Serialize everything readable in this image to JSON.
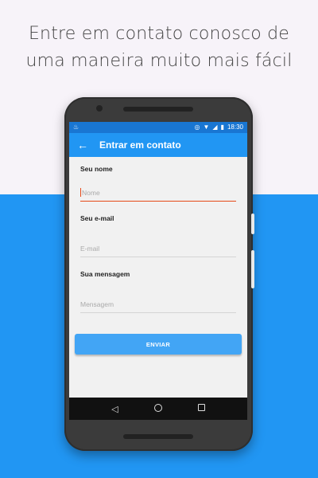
{
  "headline": {
    "line1": "Entre em contato conosco de",
    "line2": "uma maneira muito mais fácil"
  },
  "statusbar": {
    "time": "18:30",
    "icons": [
      "android-icon",
      "vibrate-icon",
      "wifi-icon",
      "signal-icon",
      "battery-icon"
    ]
  },
  "appbar": {
    "title": "Entrar em contato",
    "back_icon": "arrow-left-icon"
  },
  "form": {
    "name_label": "Seu nome",
    "name_placeholder": "Nome",
    "email_label": "Seu e-mail",
    "email_placeholder": "E-mail",
    "message_label": "Sua mensagem",
    "message_placeholder": "Mensagem",
    "send_label": "ENVIAR"
  },
  "colors": {
    "background_top": "#f7f3f9",
    "background_bottom": "#2196f3",
    "appbar": "#2196f3",
    "statusbar": "#1976d2",
    "active_field": "#e64a19",
    "button": "#42a5f5"
  }
}
